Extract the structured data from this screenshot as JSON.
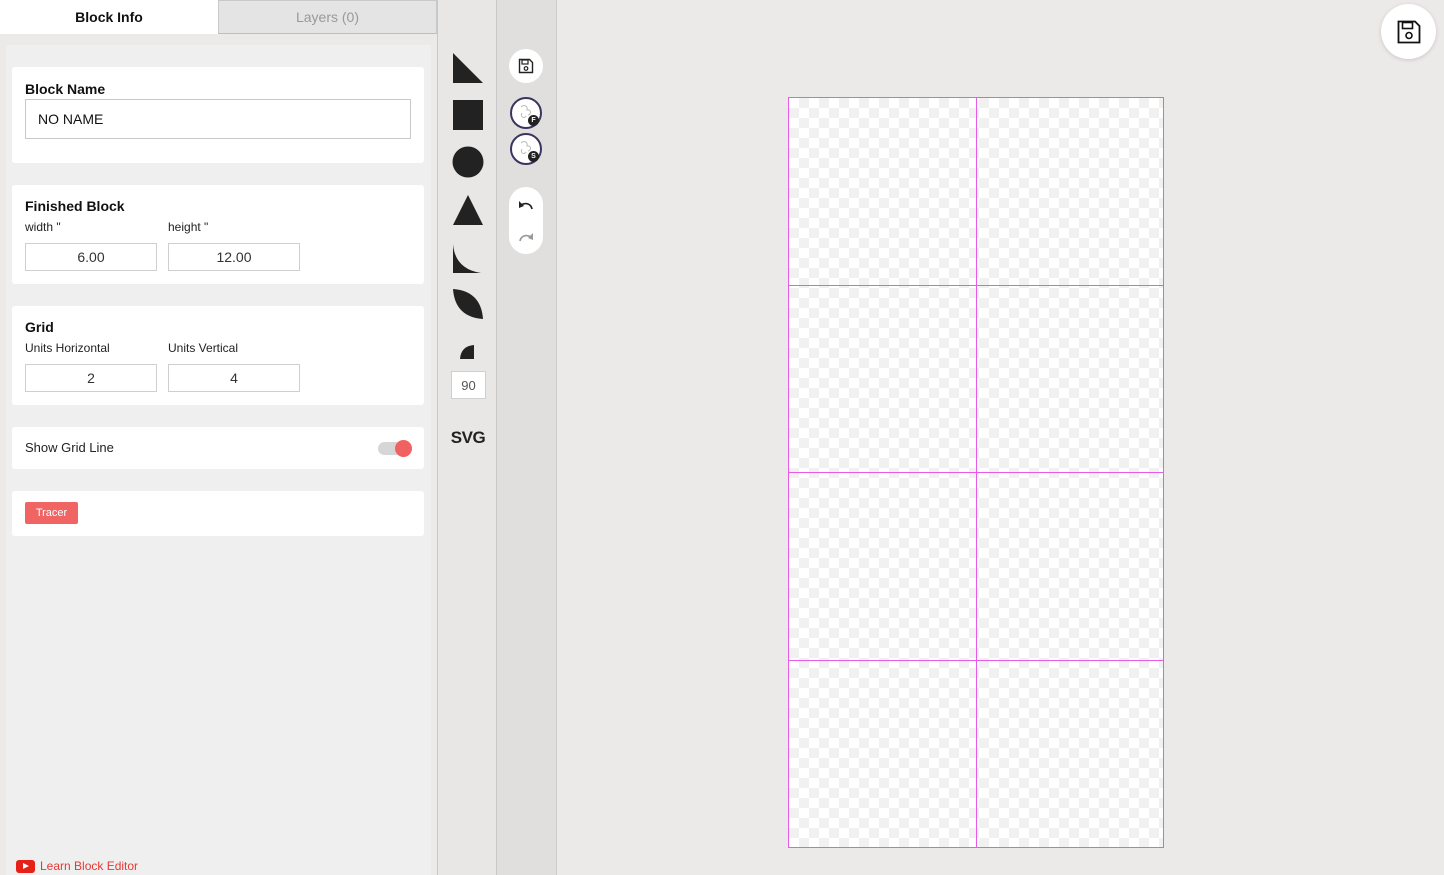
{
  "tabs": {
    "block_info": "Block Info",
    "layers": "Layers (0)"
  },
  "block_name": {
    "title": "Block Name",
    "value": "NO NAME"
  },
  "finished_block": {
    "title": "Finished Block",
    "width_label": "width \"",
    "height_label": "height \"",
    "width_value": "6.00",
    "height_value": "12.00"
  },
  "grid": {
    "title": "Grid",
    "h_label": "Units Horizontal",
    "v_label": "Units Vertical",
    "h_value": "2",
    "v_value": "4"
  },
  "grid_line": {
    "label": "Show Grid Line",
    "enabled": true
  },
  "tracer": {
    "button": "Tracer"
  },
  "learn_link": "Learn Block Editor",
  "shapes": {
    "items": [
      "right-triangle",
      "square",
      "circle",
      "triangle",
      "quarter-curve",
      "leaf",
      "arc-wedge"
    ],
    "angle_value": "90",
    "svg_label": "SVG"
  },
  "actions": {
    "fabric_badge": "F",
    "stroke_badge": "S"
  },
  "canvas": {
    "grid_color": "#e85be8",
    "columns": 2,
    "rows": 4
  },
  "colors": {
    "accent": "#f06464",
    "swatch_border": "#3a3560"
  }
}
